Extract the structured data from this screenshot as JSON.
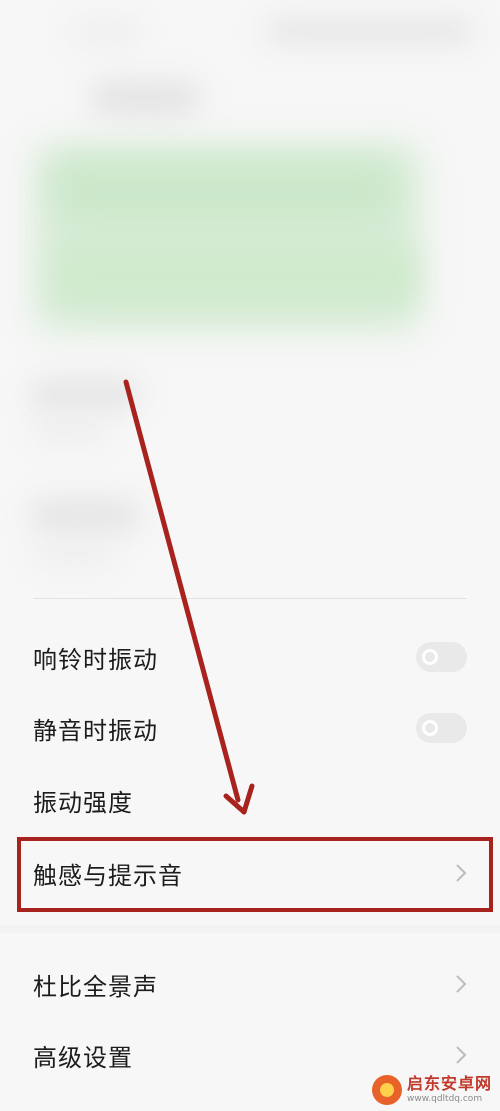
{
  "settings": {
    "items": [
      {
        "label": "响铃时振动",
        "control": "toggle",
        "on": false
      },
      {
        "label": "静音时振动",
        "control": "toggle",
        "on": false
      },
      {
        "label": "振动强度",
        "control": "none"
      },
      {
        "label": "触感与提示音",
        "control": "chevron"
      },
      {
        "label": "杜比全景声",
        "control": "chevron"
      },
      {
        "label": "高级设置",
        "control": "chevron"
      }
    ]
  },
  "icons": {
    "chevron": "chevron-right-icon"
  },
  "colors": {
    "annotation": "#a8221e",
    "toggle_off": "#e9e9e9"
  },
  "watermark": {
    "title": "启东安卓网",
    "url": "www.qdltdq.com"
  }
}
